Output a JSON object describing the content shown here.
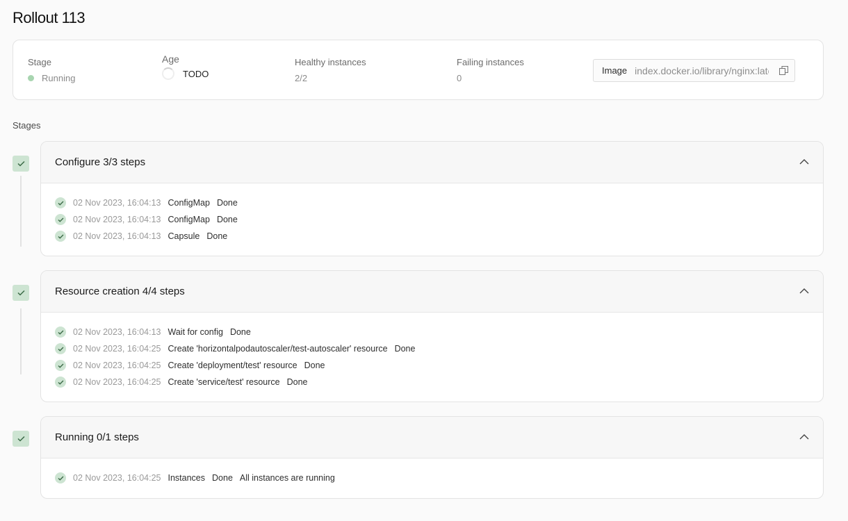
{
  "page": {
    "title": "Rollout 113"
  },
  "summary": {
    "stage": {
      "label": "Stage",
      "value": "Running"
    },
    "age": {
      "label": "Age",
      "value": "TODO"
    },
    "healthy": {
      "label": "Healthy instances",
      "value": "2/2"
    },
    "failing": {
      "label": "Failing instances",
      "value": "0"
    },
    "image": {
      "label": "Image",
      "value": "index.docker.io/library/nginx:latest"
    }
  },
  "stages_heading": "Stages",
  "stages": [
    {
      "title": "Configure 3/3 steps",
      "steps": [
        {
          "time": "02 Nov 2023, 16:04:13",
          "name": "ConfigMap",
          "status": "Done",
          "message": ""
        },
        {
          "time": "02 Nov 2023, 16:04:13",
          "name": "ConfigMap",
          "status": "Done",
          "message": ""
        },
        {
          "time": "02 Nov 2023, 16:04:13",
          "name": "Capsule",
          "status": "Done",
          "message": ""
        }
      ]
    },
    {
      "title": "Resource creation 4/4 steps",
      "steps": [
        {
          "time": "02 Nov 2023, 16:04:13",
          "name": "Wait for config",
          "status": "Done",
          "message": ""
        },
        {
          "time": "02 Nov 2023, 16:04:25",
          "name": "Create 'horizontalpodautoscaler/test-autoscaler' resource",
          "status": "Done",
          "message": ""
        },
        {
          "time": "02 Nov 2023, 16:04:25",
          "name": "Create 'deployment/test' resource",
          "status": "Done",
          "message": ""
        },
        {
          "time": "02 Nov 2023, 16:04:25",
          "name": "Create 'service/test' resource",
          "status": "Done",
          "message": ""
        }
      ]
    },
    {
      "title": "Running 0/1 steps",
      "steps": [
        {
          "time": "02 Nov 2023, 16:04:25",
          "name": "Instances",
          "status": "Done",
          "message": "All instances are running"
        }
      ]
    }
  ],
  "colors": {
    "success_bg": "#cde4d2",
    "success_fg": "#3c6b47",
    "running_dot": "#a8d5b0"
  }
}
